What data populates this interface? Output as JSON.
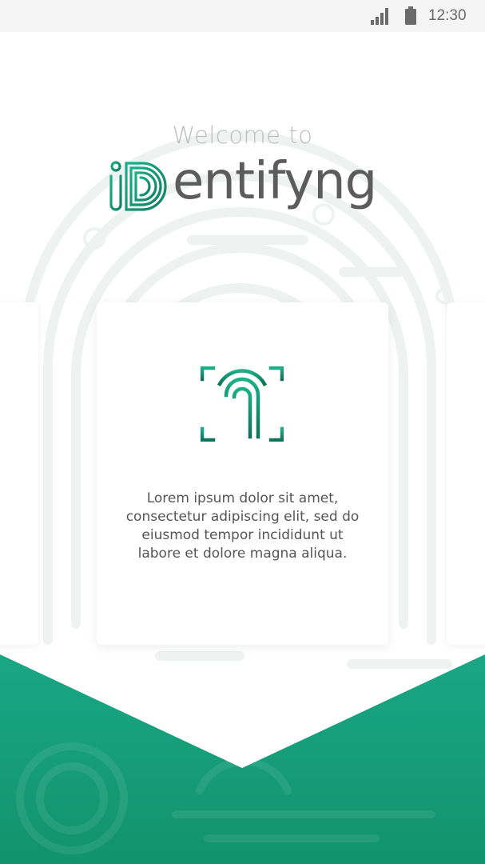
{
  "status_bar": {
    "time": "12:30",
    "icons": [
      "cell-signal-icon",
      "battery-icon"
    ]
  },
  "header": {
    "welcome_text": "Welcome to",
    "brand_word": "entifyng",
    "brand_mark_text": "iD"
  },
  "card": {
    "icon": "fingerprint-scan-icon",
    "description": "Lorem ipsum dolor sit amet, consectetur adipiscing elit, sed do eiusmod tempor incididunt ut labore et dolore magna aliqua."
  },
  "colors": {
    "brand_green": "#1aa784",
    "brand_green_dark": "#0f7f63",
    "text_gray": "#5c5c5c",
    "welcome_gray": "#bdbdbd"
  }
}
